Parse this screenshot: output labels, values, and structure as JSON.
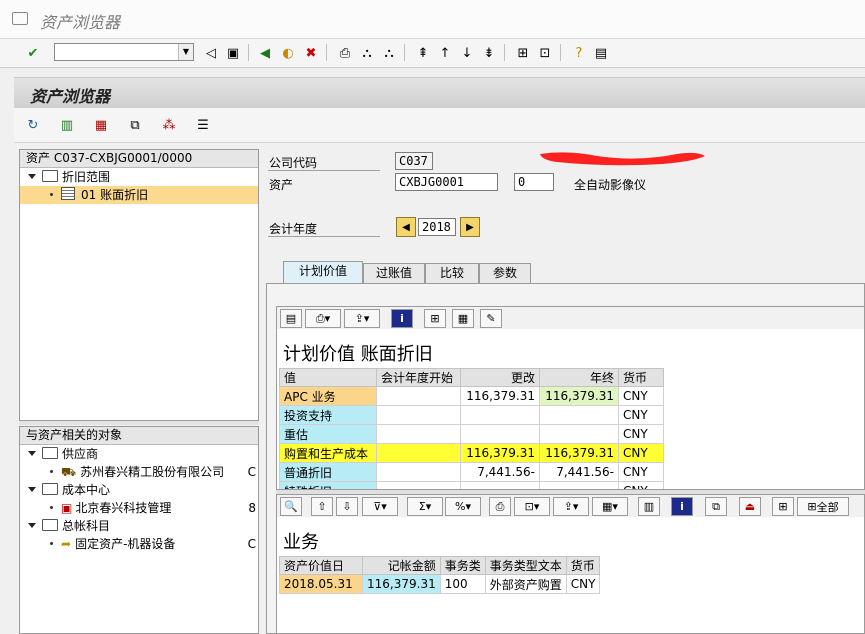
{
  "window": {
    "title": "资产浏览器"
  },
  "page": {
    "heading": "资产浏览器"
  },
  "tree1": {
    "header": "资产 C037-CXBJG0001/0000",
    "root": "折旧范围",
    "child": "01  账面折旧"
  },
  "tree2": {
    "header": "与资产相关的对象",
    "groups": [
      {
        "label": "供应商",
        "item": "苏州春兴精工股份有限公司",
        "extra": "C"
      },
      {
        "label": "成本中心",
        "item": "北京春兴科技管理",
        "extra": "8"
      },
      {
        "label": "总帐科目",
        "item": "固定资产-机器设备",
        "extra": "C"
      }
    ]
  },
  "form": {
    "company_label": "公司代码",
    "company_value": "C037",
    "asset_label": "资产",
    "asset_value": "CXBJG0001",
    "sub_value": "0",
    "asset_desc": "全自动影像仪",
    "year_label": "会计年度",
    "year_value": "2018"
  },
  "tabs": [
    "计划价值",
    "过账值",
    "比较",
    "参数"
  ],
  "grid1": {
    "title": "计划价值 账面折旧",
    "columns": [
      "值",
      "会计年度开始",
      "更改",
      "年终",
      "货币"
    ],
    "rows": [
      [
        "APC 业务",
        "",
        "116,379.31",
        "116,379.31",
        "CNY"
      ],
      [
        "投资支持",
        "",
        "",
        "",
        "CNY"
      ],
      [
        "重估",
        "",
        "",
        "",
        "CNY"
      ],
      [
        "购置和生产成本",
        "",
        "116,379.31",
        "116,379.31",
        "CNY"
      ],
      [
        "普通折旧",
        "",
        "7,441.56-",
        "7,441.56-",
        "CNY"
      ],
      [
        "特殊折旧",
        "",
        "",
        "",
        "CNY"
      ]
    ]
  },
  "grid2": {
    "title": "业务",
    "all_label": "全部",
    "columns": [
      "资产价值日",
      "记帐金额",
      "事务类",
      "事务类型文本",
      "货币"
    ],
    "rows": [
      [
        "2018.05.31",
        "116,379.31",
        "100",
        "外部资产购置",
        "CNY"
      ]
    ]
  },
  "colors": {
    "accent_yellow": "#ffff33",
    "cyan": "#b7ecf7",
    "orange": "#fbd58a"
  }
}
